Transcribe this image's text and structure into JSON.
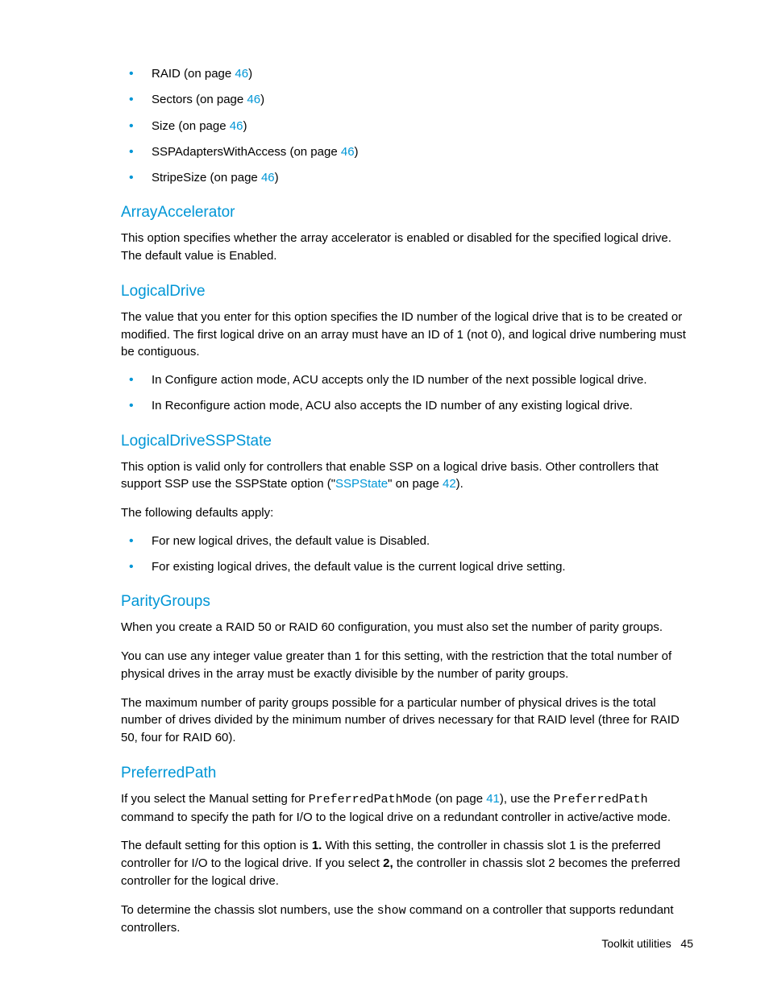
{
  "topList": [
    {
      "label": "RAID",
      "onPage": " (on page ",
      "pageRef": "46",
      "close": ")"
    },
    {
      "label": "Sectors",
      "onPage": " (on page ",
      "pageRef": "46",
      "close": ")"
    },
    {
      "label": "Size",
      "onPage": " (on page ",
      "pageRef": "46",
      "close": ")"
    },
    {
      "label": "SSPAdaptersWithAccess",
      "onPage": " (on page ",
      "pageRef": "46",
      "close": ")"
    },
    {
      "label": "StripeSize",
      "onPage": " (on page ",
      "pageRef": "46",
      "close": ")"
    }
  ],
  "sections": {
    "arrayAccelerator": {
      "title": "ArrayAccelerator",
      "p1": "This option specifies whether the array accelerator is enabled or disabled for the specified logical drive. The default value is Enabled."
    },
    "logicalDrive": {
      "title": "LogicalDrive",
      "p1": "The value that you enter for this option specifies the ID number of the logical drive that is to be created or modified. The first logical drive on an array must have an ID of 1 (not 0), and logical drive numbering must be contiguous.",
      "bullets": [
        "In Configure action mode, ACU accepts only the ID number of the next possible logical drive.",
        "In Reconfigure action mode, ACU also accepts the ID number of any existing logical drive."
      ]
    },
    "logicalDriveSSPState": {
      "title": "LogicalDriveSSPState",
      "p1a": "This option is valid only for controllers that enable SSP on a logical drive basis. Other controllers that support SSP use the SSPState option (\"",
      "link": "SSPState",
      "p1b": "\" on page ",
      "pageRef": "42",
      "p1c": ").",
      "p2": "The following defaults apply:",
      "bullets": [
        "For new logical drives, the default value is Disabled.",
        "For existing logical drives, the default value is the current logical drive setting."
      ]
    },
    "parityGroups": {
      "title": "ParityGroups",
      "p1": "When you create a RAID 50 or RAID 60 configuration, you must also set the number of parity groups.",
      "p2": "You can use any integer value greater than 1 for this setting, with the restriction that the total number of physical drives in the array must be exactly divisible by the number of parity groups.",
      "p3": "The maximum number of parity groups possible for a particular number of physical drives is the total number of drives divided by the minimum number of drives necessary for that RAID level (three for RAID 50, four for RAID 60)."
    },
    "preferredPath": {
      "title": "PreferredPath",
      "p1a": "If you select the Manual setting for ",
      "code1": "PreferredPathMode",
      "p1b": " (on page ",
      "pageRef": "41",
      "p1c": "), use the ",
      "code2": "PreferredPath",
      "p1d": " command to specify the path for I/O to the logical drive on a redundant controller in active/active mode.",
      "p2a": "The default setting for this option is ",
      "bold1": "1.",
      "p2b": " With this setting, the controller in chassis slot 1 is the preferred controller for I/O to the logical drive. If you select ",
      "bold2": "2,",
      "p2c": " the controller in chassis slot 2 becomes the preferred controller for the logical drive.",
      "p3a": "To determine the chassis slot numbers, use the ",
      "code3": "show",
      "p3b": " command on a controller that supports redundant controllers."
    }
  },
  "footer": {
    "label": "Toolkit utilities",
    "page": "45"
  }
}
